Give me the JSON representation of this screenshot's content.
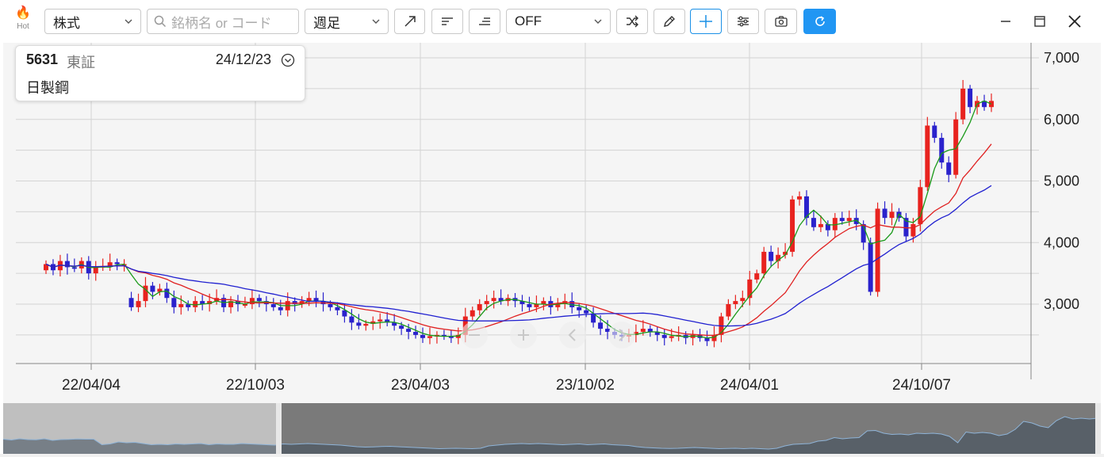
{
  "toolbar": {
    "hot_label": "Hot",
    "asset_type": "株式",
    "search_placeholder": "銘柄名 or コード",
    "period": "週足",
    "indicator": "OFF",
    "icons": [
      "trend-line-icon",
      "align-left-icon",
      "align-right-icon",
      "shuffle-icon",
      "pencil-icon",
      "crosshair-icon",
      "settings-sliders-icon",
      "camera-icon",
      "refresh-icon"
    ],
    "accent_color": "#2196f3"
  },
  "window": {
    "icons": [
      "minimize-icon",
      "maximize-icon",
      "close-icon"
    ]
  },
  "info": {
    "code": "5631",
    "market": "東証",
    "date": "24/12/23",
    "name": "日製鋼"
  },
  "chart_data": {
    "type": "candlestick",
    "x_labels": [
      "22/04/04",
      "22/10/03",
      "23/04/03",
      "23/10/02",
      "24/04/01",
      "24/10/07"
    ],
    "y_ticks": [
      3000,
      4000,
      5000,
      6000,
      7000
    ],
    "y_tick_labels": [
      "3,000",
      "4,000",
      "5,000",
      "6,000",
      "7,000"
    ],
    "ylim": [
      2200,
      7200
    ],
    "series": [
      {
        "type": "candles",
        "color_up": "#e8231f",
        "color_down": "#2a22cc",
        "close": [
          3650,
          3550,
          3700,
          3600,
          3580,
          3700,
          3500,
          3600,
          3620,
          3680,
          3650,
          3650,
          2950,
          3050,
          3300,
          3200,
          3250,
          3100,
          2950,
          3000,
          2950,
          3050,
          3000,
          3050,
          3100,
          2950,
          3050,
          3000,
          3000,
          3100,
          3050,
          3000,
          2950,
          2900,
          3050,
          3000,
          3050,
          3100,
          3050,
          3000,
          2950,
          2900,
          2800,
          2700,
          2650,
          2680,
          2720,
          2750,
          2700,
          2650,
          2600,
          2550,
          2500,
          2450,
          2480,
          2500,
          2480,
          2450,
          2500,
          2800,
          2900,
          3000,
          3050,
          3100,
          3050,
          3100,
          3050,
          3000,
          2950,
          3000,
          3050,
          2950,
          3000,
          3050,
          2950,
          2900,
          2850,
          2700,
          2600,
          2550,
          2500,
          2480,
          2500,
          2550,
          2600,
          2550,
          2500,
          2450,
          2480,
          2500,
          2450,
          2500,
          2450,
          2400,
          2500,
          2800,
          3000,
          3050,
          3100,
          3400,
          3500,
          3850,
          3700,
          3800,
          3850,
          4700,
          4750,
          4400,
          4250,
          4300,
          4200,
          4400,
          4350,
          4400,
          4300,
          4000,
          3200,
          4550,
          4400,
          4500,
          4400,
          4100,
          4300,
          4900,
          5900,
          5700,
          5300,
          5100,
          6000,
          6500,
          6200,
          6300,
          6200,
          6300
        ],
        "open": [
          3550,
          3650,
          3550,
          3700,
          3600,
          3580,
          3700,
          3500,
          3600,
          3620,
          3680,
          3650,
          3100,
          2950,
          3050,
          3300,
          3200,
          3250,
          3100,
          2950,
          3000,
          2950,
          3050,
          3000,
          3050,
          3100,
          2950,
          3050,
          3000,
          3000,
          3100,
          3050,
          3000,
          2950,
          2900,
          3050,
          3000,
          3050,
          3100,
          3050,
          3000,
          2950,
          2900,
          2800,
          2700,
          2650,
          2680,
          2720,
          2750,
          2700,
          2650,
          2600,
          2550,
          2500,
          2450,
          2480,
          2500,
          2480,
          2450,
          2500,
          2800,
          2900,
          3000,
          3050,
          3100,
          3050,
          3100,
          3050,
          3000,
          2950,
          3000,
          3050,
          2950,
          3000,
          3050,
          2950,
          2900,
          2850,
          2700,
          2600,
          2550,
          2500,
          2480,
          2500,
          2550,
          2600,
          2550,
          2500,
          2450,
          2480,
          2500,
          2450,
          2500,
          2450,
          2400,
          2500,
          2800,
          3000,
          3050,
          3100,
          3400,
          3500,
          3850,
          3700,
          3800,
          3850,
          4700,
          4750,
          4400,
          4250,
          4300,
          4200,
          4400,
          4350,
          4400,
          4300,
          4000,
          3200,
          4550,
          4400,
          4500,
          4400,
          4100,
          4300,
          4900,
          5900,
          5700,
          5300,
          5100,
          6000,
          6500,
          6200,
          6300,
          6200
        ]
      },
      {
        "type": "line",
        "color": "#1a9a1a"
      },
      {
        "type": "line",
        "color": "#e02020"
      },
      {
        "type": "line",
        "color": "#2020d0"
      }
    ]
  }
}
